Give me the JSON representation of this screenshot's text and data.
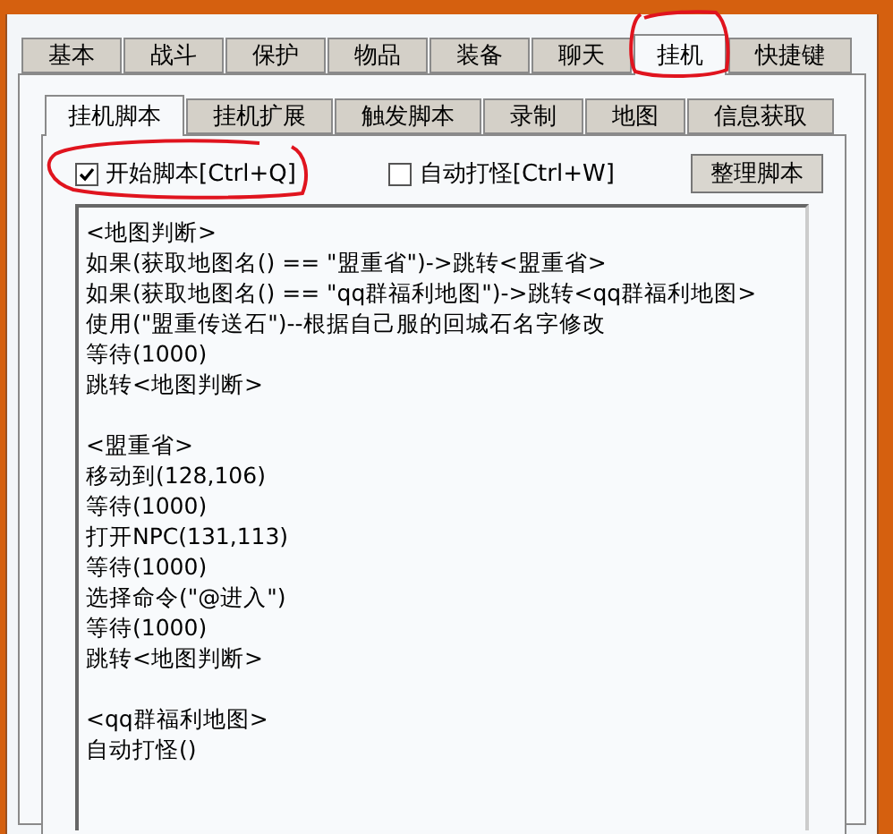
{
  "tabs": [
    {
      "label": "基本",
      "selected": false
    },
    {
      "label": "战斗",
      "selected": false
    },
    {
      "label": "保护",
      "selected": false
    },
    {
      "label": "物品",
      "selected": false
    },
    {
      "label": "装备",
      "selected": false
    },
    {
      "label": "聊天",
      "selected": false
    },
    {
      "label": "挂机",
      "selected": true,
      "circled": true
    },
    {
      "label": "快捷键",
      "selected": false
    }
  ],
  "subtabs": [
    {
      "label": "挂机脚本",
      "selected": true
    },
    {
      "label": "挂机扩展",
      "selected": false
    },
    {
      "label": "触发脚本",
      "selected": false
    },
    {
      "label": "录制",
      "selected": false
    },
    {
      "label": "地图",
      "selected": false
    },
    {
      "label": "信息获取",
      "selected": false
    }
  ],
  "options": [
    {
      "label": "开始脚本[Ctrl+Q]",
      "checked": true,
      "circled": true
    },
    {
      "label": "自动打怪[Ctrl+W]",
      "checked": false,
      "circled": false
    }
  ],
  "tidy_button": "整理脚本",
  "script_blocks": [
    {
      "lines": [
        "<地图判断>",
        "如果(获取地图名() == \"盟重省\")->跳转<盟重省>",
        "如果(获取地图名() == \"qq群福利地图\")->跳转<qq群福利地图>",
        "使用(\"盟重传送石\")--根据自己服的回城石名字修改",
        "等待(1000)",
        "跳转<地图判断>"
      ]
    },
    {
      "lines": [
        "<盟重省>",
        "移动到(128,106)",
        "等待(1000)",
        "打开NPC(131,113)",
        "等待(1000)",
        "选择命令(\"@进入\")",
        "等待(1000)",
        "跳转<地图判断>"
      ]
    },
    {
      "lines": [
        "<qq群福利地图>",
        "自动打怪()"
      ]
    }
  ]
}
